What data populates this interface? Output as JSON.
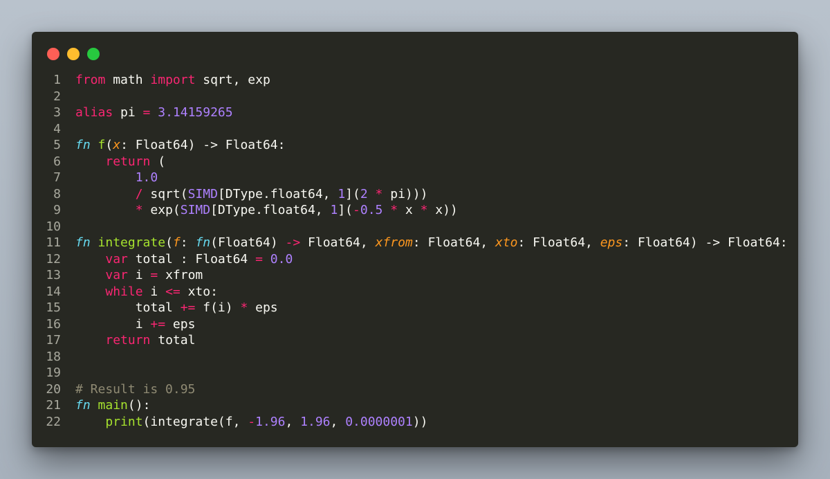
{
  "colors": {
    "background": "#aab3bd",
    "editor_background": "#272822",
    "line_number": "#a9a99e",
    "keyword": "#f92672",
    "storage": "#66d9ef",
    "function": "#a6e22e",
    "number": "#ae81ff",
    "parameter": "#fd971f",
    "comment": "#8f8a73",
    "text": "#f8f8f2",
    "dot_red": "#ff5f56",
    "dot_yellow": "#ffbd2e",
    "dot_green": "#27c93f"
  },
  "window_controls": [
    "close-dot",
    "minimize-dot",
    "maximize-dot"
  ],
  "code": {
    "lines": [
      {
        "num": "1",
        "tokens": [
          [
            "keyword",
            "from"
          ],
          [
            "plain",
            " math "
          ],
          [
            "keyword",
            "import"
          ],
          [
            "plain",
            " sqrt, exp"
          ]
        ]
      },
      {
        "num": "2",
        "tokens": []
      },
      {
        "num": "3",
        "tokens": [
          [
            "keyword",
            "alias"
          ],
          [
            "plain",
            " pi "
          ],
          [
            "keyword",
            "="
          ],
          [
            "plain",
            " "
          ],
          [
            "number",
            "3.14159265"
          ]
        ]
      },
      {
        "num": "4",
        "tokens": []
      },
      {
        "num": "5",
        "tokens": [
          [
            "storage",
            "fn"
          ],
          [
            "plain",
            " "
          ],
          [
            "func",
            "f"
          ],
          [
            "plain",
            "("
          ],
          [
            "param",
            "x"
          ],
          [
            "plain",
            ": Float64) -> Float64:"
          ]
        ]
      },
      {
        "num": "6",
        "tokens": [
          [
            "plain",
            "    "
          ],
          [
            "keyword",
            "return"
          ],
          [
            "plain",
            " ("
          ]
        ]
      },
      {
        "num": "7",
        "tokens": [
          [
            "plain",
            "        "
          ],
          [
            "number",
            "1.0"
          ]
        ]
      },
      {
        "num": "8",
        "tokens": [
          [
            "plain",
            "        "
          ],
          [
            "keyword",
            "/"
          ],
          [
            "plain",
            " sqrt("
          ],
          [
            "number",
            "SIMD"
          ],
          [
            "plain",
            "[DType.float64, "
          ],
          [
            "number",
            "1"
          ],
          [
            "plain",
            "]("
          ],
          [
            "number",
            "2"
          ],
          [
            "plain",
            " "
          ],
          [
            "keyword",
            "*"
          ],
          [
            "plain",
            " pi)))"
          ]
        ]
      },
      {
        "num": "9",
        "tokens": [
          [
            "plain",
            "        "
          ],
          [
            "keyword",
            "*"
          ],
          [
            "plain",
            " exp("
          ],
          [
            "number",
            "SIMD"
          ],
          [
            "plain",
            "[DType.float64, "
          ],
          [
            "number",
            "1"
          ],
          [
            "plain",
            "]("
          ],
          [
            "keyword",
            "-"
          ],
          [
            "number",
            "0.5"
          ],
          [
            "plain",
            " "
          ],
          [
            "keyword",
            "*"
          ],
          [
            "plain",
            " x "
          ],
          [
            "keyword",
            "*"
          ],
          [
            "plain",
            " x))"
          ]
        ]
      },
      {
        "num": "10",
        "tokens": []
      },
      {
        "num": "11",
        "tokens": [
          [
            "storage",
            "fn"
          ],
          [
            "plain",
            " "
          ],
          [
            "func",
            "integrate"
          ],
          [
            "plain",
            "("
          ],
          [
            "param",
            "f"
          ],
          [
            "plain",
            ": "
          ],
          [
            "storage",
            "fn"
          ],
          [
            "plain",
            "(Float64) "
          ],
          [
            "keyword",
            "->"
          ],
          [
            "plain",
            " Float64, "
          ],
          [
            "param",
            "xfrom"
          ],
          [
            "plain",
            ": Float64, "
          ],
          [
            "param",
            "xto"
          ],
          [
            "plain",
            ": Float64, "
          ],
          [
            "param",
            "eps"
          ],
          [
            "plain",
            ": Float64) -> Float64:"
          ]
        ]
      },
      {
        "num": "12",
        "tokens": [
          [
            "plain",
            "    "
          ],
          [
            "keyword",
            "var"
          ],
          [
            "plain",
            " total : Float64 "
          ],
          [
            "keyword",
            "="
          ],
          [
            "plain",
            " "
          ],
          [
            "number",
            "0.0"
          ]
        ]
      },
      {
        "num": "13",
        "tokens": [
          [
            "plain",
            "    "
          ],
          [
            "keyword",
            "var"
          ],
          [
            "plain",
            " i "
          ],
          [
            "keyword",
            "="
          ],
          [
            "plain",
            " xfrom"
          ]
        ]
      },
      {
        "num": "14",
        "tokens": [
          [
            "plain",
            "    "
          ],
          [
            "keyword",
            "while"
          ],
          [
            "plain",
            " i "
          ],
          [
            "keyword",
            "<="
          ],
          [
            "plain",
            " xto:"
          ]
        ]
      },
      {
        "num": "15",
        "tokens": [
          [
            "plain",
            "        total "
          ],
          [
            "keyword",
            "+="
          ],
          [
            "plain",
            " f(i) "
          ],
          [
            "keyword",
            "*"
          ],
          [
            "plain",
            " eps"
          ]
        ]
      },
      {
        "num": "16",
        "tokens": [
          [
            "plain",
            "        i "
          ],
          [
            "keyword",
            "+="
          ],
          [
            "plain",
            " eps"
          ]
        ]
      },
      {
        "num": "17",
        "tokens": [
          [
            "plain",
            "    "
          ],
          [
            "keyword",
            "return"
          ],
          [
            "plain",
            " total"
          ]
        ]
      },
      {
        "num": "18",
        "tokens": []
      },
      {
        "num": "19",
        "tokens": []
      },
      {
        "num": "20",
        "tokens": [
          [
            "comment",
            "# Result is 0.95"
          ]
        ]
      },
      {
        "num": "21",
        "tokens": [
          [
            "storage",
            "fn"
          ],
          [
            "plain",
            " "
          ],
          [
            "func",
            "main"
          ],
          [
            "plain",
            "():"
          ]
        ]
      },
      {
        "num": "22",
        "tokens": [
          [
            "plain",
            "    "
          ],
          [
            "func",
            "print"
          ],
          [
            "plain",
            "(integrate(f, "
          ],
          [
            "keyword",
            "-"
          ],
          [
            "number",
            "1.96"
          ],
          [
            "plain",
            ", "
          ],
          [
            "number",
            "1.96"
          ],
          [
            "plain",
            ", "
          ],
          [
            "number",
            "0.0000001"
          ],
          [
            "plain",
            "))"
          ]
        ]
      }
    ]
  }
}
